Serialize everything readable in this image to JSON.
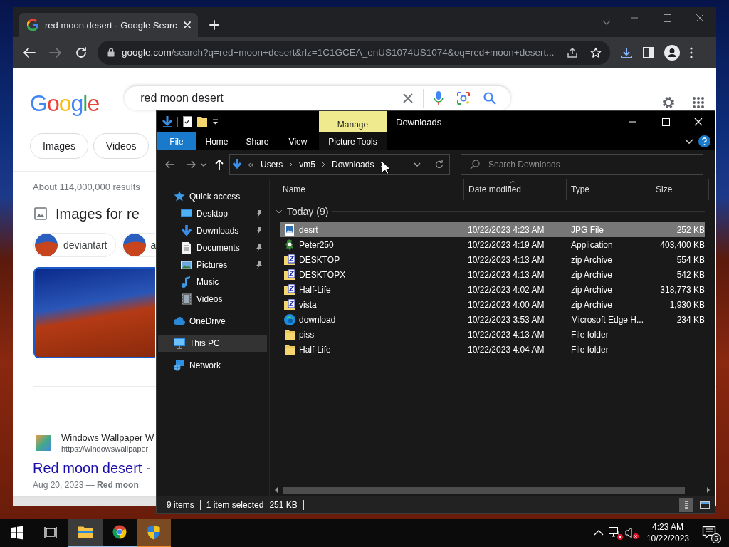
{
  "browser": {
    "tab": {
      "title": "red moon desert - Google Searc",
      "selected": true
    },
    "url_host": "google.com",
    "url_path": "/search?q=red+moon+desert&rlz=1C1GCEA_enUS1074US1074&oq=red+moon+desert...",
    "forward_disabled": true,
    "page": {
      "logo": "Google",
      "query": "red moon desert",
      "filters": [
        "Images",
        "Videos"
      ],
      "result_stats": "About 114,000,000 results",
      "images_heading": "Images for re",
      "image_chips": [
        "deviantart",
        "a"
      ],
      "result": {
        "site_name": "Windows Wallpaper W",
        "url": "https://windowswallpaper",
        "title": "Red moon desert -",
        "snippet": "Aug 20, 2023 — **Red moon**"
      }
    }
  },
  "explorer": {
    "title": "Downloads",
    "context_tab": "Manage",
    "ribbon_tabs": [
      {
        "label": "File",
        "kind": "file"
      },
      {
        "label": "Home",
        "kind": "tab"
      },
      {
        "label": "Share",
        "kind": "tab"
      },
      {
        "label": "View",
        "kind": "tab"
      },
      {
        "label": "Picture Tools",
        "kind": "contextual"
      }
    ],
    "path": [
      "Users",
      "vm5",
      "Downloads"
    ],
    "search_placeholder": "Search Downloads",
    "nav": [
      {
        "label": "Quick access",
        "kind": "star",
        "selected": false,
        "children": [
          {
            "label": "Desktop",
            "kind": "desktop",
            "pinned": true,
            "selected": false
          },
          {
            "label": "Downloads",
            "kind": "download",
            "pinned": true,
            "selected": false
          },
          {
            "label": "Documents",
            "kind": "document",
            "pinned": true,
            "selected": false
          },
          {
            "label": "Pictures",
            "kind": "pictures",
            "pinned": true,
            "selected": false
          },
          {
            "label": "Music",
            "kind": "music",
            "pinned": false,
            "selected": false
          },
          {
            "label": "Videos",
            "kind": "videos",
            "pinned": false,
            "selected": false
          }
        ]
      },
      {
        "label": "OneDrive",
        "kind": "cloud",
        "selected": false
      },
      {
        "label": "This PC",
        "kind": "pc",
        "selected": true
      },
      {
        "label": "Network",
        "kind": "network",
        "selected": false
      }
    ],
    "columns": [
      {
        "label": "Name",
        "sorted": false
      },
      {
        "label": "Date modified",
        "sorted": true
      },
      {
        "label": "Type",
        "sorted": false
      },
      {
        "label": "Size",
        "sorted": false
      }
    ],
    "group": {
      "label": "Today (9)",
      "expanded": true
    },
    "files": [
      {
        "name": "desrt",
        "date": "10/22/2023 4:23 AM",
        "type": "JPG File",
        "size": "252 KB",
        "kind": "image",
        "selected": true
      },
      {
        "name": "Peter250",
        "date": "10/22/2023 4:19 AM",
        "type": "Application",
        "size": "403,400 KB",
        "kind": "app",
        "selected": false
      },
      {
        "name": "DESKTOP",
        "date": "10/22/2023 4:13 AM",
        "type": "zip Archive",
        "size": "554 KB",
        "kind": "zip",
        "selected": false
      },
      {
        "name": "DESKTOPX",
        "date": "10/22/2023 4:13 AM",
        "type": "zip Archive",
        "size": "542 KB",
        "kind": "zip",
        "selected": false
      },
      {
        "name": "Half-Life",
        "date": "10/22/2023 4:02 AM",
        "type": "zip Archive",
        "size": "318,773 KB",
        "kind": "zip",
        "selected": false
      },
      {
        "name": "vista",
        "date": "10/22/2023 4:00 AM",
        "type": "zip Archive",
        "size": "1,930 KB",
        "kind": "zip",
        "selected": false
      },
      {
        "name": "download",
        "date": "10/22/2023 3:53 AM",
        "type": "Microsoft Edge H...",
        "size": "234 KB",
        "kind": "edge",
        "selected": false
      },
      {
        "name": "piss",
        "date": "10/22/2023 4:13 AM",
        "type": "File folder",
        "kind": "folder",
        "selected": false
      },
      {
        "name": "Half-Life",
        "date": "10/22/2023 4:04 AM",
        "type": "File folder",
        "kind": "folder",
        "selected": false
      }
    ],
    "status": {
      "count": "9 items",
      "selection": "1 item selected",
      "selection_size": "251 KB"
    },
    "views": [
      {
        "kind": "details",
        "selected": true
      },
      {
        "kind": "tiles",
        "selected": false
      }
    ]
  },
  "taskbar": {
    "apps": [
      {
        "kind": "explorer",
        "selected": true,
        "flashing": false
      },
      {
        "kind": "chrome",
        "selected": false,
        "flashing": false
      },
      {
        "kind": "shield",
        "selected": false,
        "flashing": true
      }
    ],
    "time": "4:23 AM",
    "date": "10/22/2023",
    "notification_count": "5"
  }
}
